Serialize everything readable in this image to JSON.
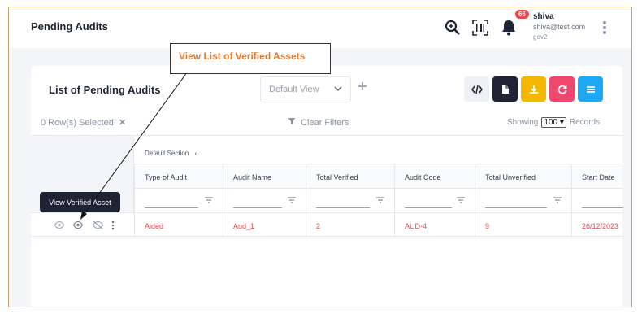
{
  "header": {
    "title": "Pending Audits",
    "notification_count": "66",
    "user": {
      "name": "shiva",
      "email": "shiva@test.com",
      "org": "gov2"
    }
  },
  "card": {
    "title": "List of Pending Audits",
    "view_select": "Default View",
    "rows_selected": "0 Row(s) Selected",
    "clear_filters": "Clear Filters",
    "showing_label": "Showing",
    "showing_value": "100",
    "records_label": "Records",
    "section_label": "Default Section",
    "action_buttons": [
      {
        "name": "code-view",
        "color": "#eef1f6"
      },
      {
        "name": "document",
        "color": "#1e2433"
      },
      {
        "name": "download",
        "color": "#f5b800"
      },
      {
        "name": "refresh",
        "color": "#f0476e"
      },
      {
        "name": "columns",
        "color": "#1ea7f5"
      }
    ]
  },
  "table": {
    "columns": [
      "Type of Audit",
      "Audit Name",
      "Total Verified",
      "Audit Code",
      "Total Unverified",
      "Start Date"
    ],
    "rows": [
      [
        "Aided",
        "Aud_1",
        "2",
        "AUD-4",
        "9",
        "26/12/2023"
      ]
    ]
  },
  "tooltip": "View Verified Asset",
  "callout": "View List of Verified Assets"
}
